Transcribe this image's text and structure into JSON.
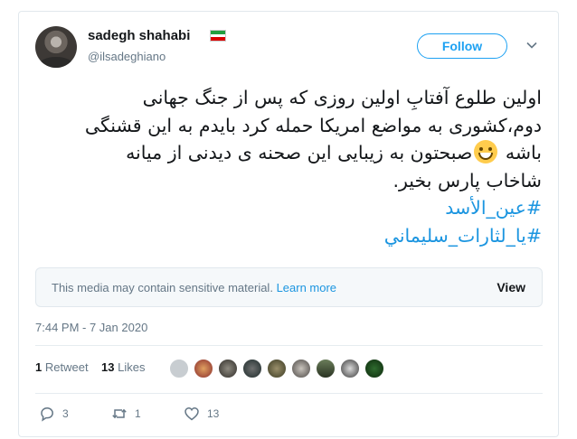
{
  "user": {
    "display_name": "sadegh shahabi",
    "handle": "@ilsadeghiano",
    "flag_icon": "iran-flag-icon",
    "flag_colors": [
      "#239f40",
      "#ffffff",
      "#da0000"
    ]
  },
  "follow_label": "Follow",
  "tweet": {
    "lines": [
      "اولین طلوع آفتابِ اولین روزی که پس از جنگ جهانی",
      "دوم،کشوری به مواضع امریکا حمله کرد بایدم به این قشنگی",
      "صبحتون به زیبایی این صحنه ی دیدنی از میانه"
    ],
    "line3_prefix": "باشه",
    "line4": "شاخاب پارس بخیر.",
    "hashtags": [
      "#عین_الأسد",
      "#یا_لثارات_سلیماني"
    ],
    "emoji": "grinning-face-icon"
  },
  "sensitive": {
    "message": "This media may contain sensitive material.",
    "learn_more": "Learn more",
    "view_label": "View"
  },
  "timestamp": "7:44 PM - 7 Jan 2020",
  "stats": {
    "retweets_count": "1",
    "retweets_label": "Retweet",
    "likes_count": "13",
    "likes_label": "Likes"
  },
  "actions": {
    "replies": "3",
    "retweets": "1",
    "likes": "13"
  },
  "colors": {
    "accent": "#1da1f2",
    "link": "#1b95e0",
    "muted": "#657786",
    "text": "#14171a",
    "border": "#e1e8ed"
  }
}
